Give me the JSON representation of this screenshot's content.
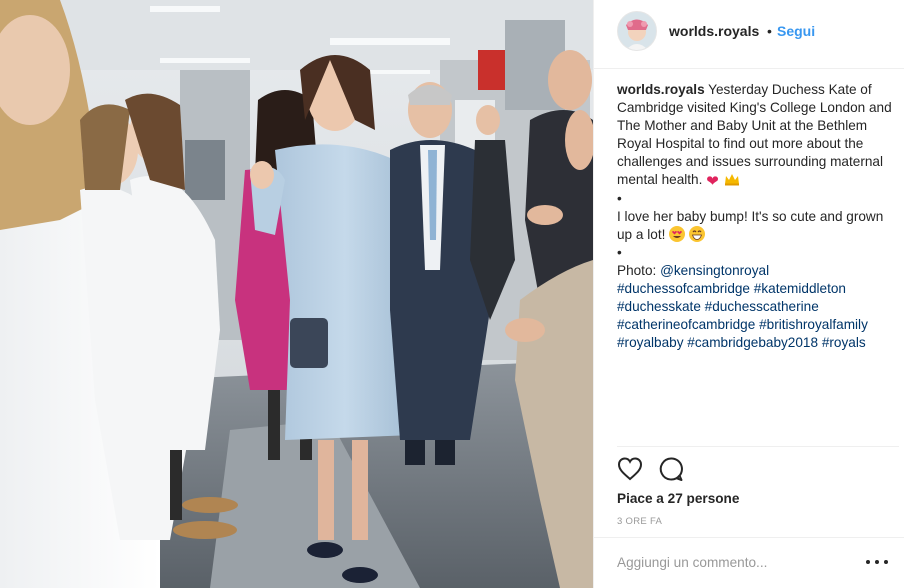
{
  "post": {
    "username": "worlds.royals",
    "separator": "•",
    "follow_label": "Segui",
    "caption": {
      "username": "worlds.royals",
      "line1": " Yesterday Duchess Kate of",
      "line2": "Cambridge visited King's College London and",
      "line3": "The Mother and Baby Unit at the Bethlem",
      "line4": "Royal Hospital to find out more about the",
      "line5": "challenges and issues surrounding maternal",
      "line6": "mental health.",
      "bullet1": "•",
      "line7": "I love her baby bump! It's so cute and grown",
      "line8": "up a lot!",
      "bullet2": "•",
      "photo_prefix": "Photo: ",
      "photo_tag": "@kensingtonroyal",
      "tag1": "#duchessofcambridge",
      "tag2": "#katemiddleton",
      "tag3": "#duchesskate",
      "tag4": "#duchesscatherine",
      "tag5": "#catherineofcambridge",
      "tag6": "#britishroyalfamily",
      "tag7": "#royalbaby",
      "tag8": "#cambridgebaby2018",
      "tag9": "#royals"
    },
    "likes_text": "Piace a 27 persone",
    "time_text": "3 ORE FA",
    "comment_placeholder": "Aggiungi un commento...",
    "colors": {
      "follow": "#3897f0",
      "hashtag": "#003569",
      "heart_emoji": "#e0245e"
    },
    "icons": [
      "like-heart-icon",
      "comment-bubble-icon",
      "more-options-icon",
      "heart-emoji-icon",
      "crown-emoji-icon",
      "heart-eyes-emoji-icon",
      "grinning-emoji-icon"
    ]
  }
}
